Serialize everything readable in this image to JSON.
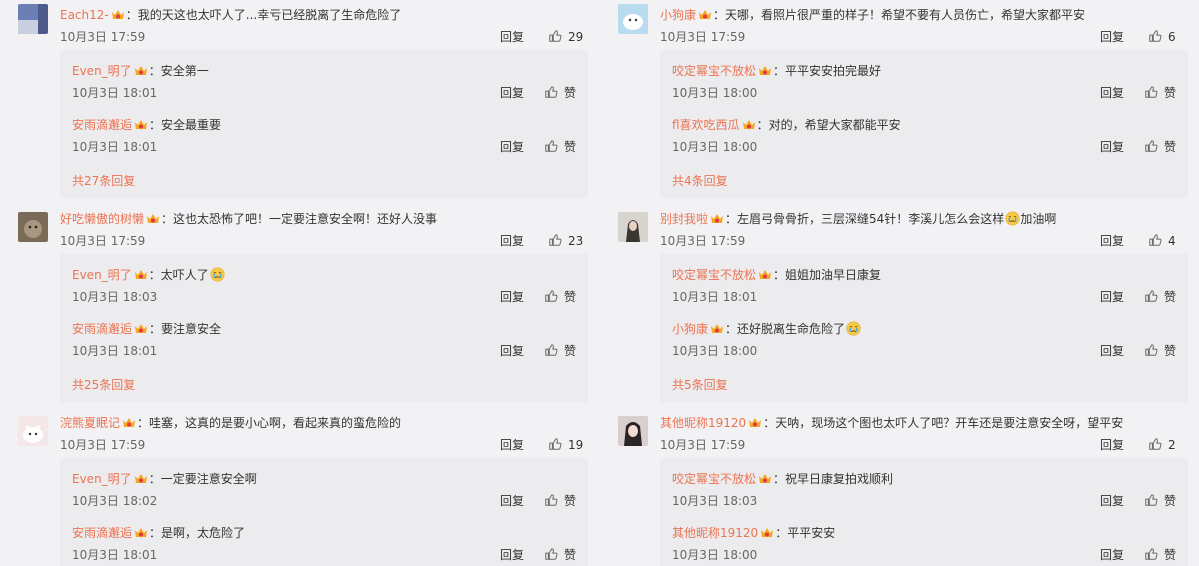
{
  "colors": {
    "name": "#eb7350",
    "text": "#333333",
    "meta": "#666666",
    "sub_bg": "#ececef"
  },
  "icons": {
    "vip": "vip-crown-icon",
    "like": "thumbs-up-icon",
    "emoji": "crying-face-icon"
  },
  "reply_label": "回复",
  "left": [
    {
      "user": "Each12-",
      "text": "我的天这也太吓人了...幸亏已经脱离了生命危险了",
      "time": "10月3日 17:59",
      "reply": "回复",
      "likes": "29",
      "subs": [
        {
          "user": "Even_明了",
          "text": "安全第一",
          "time": "10月3日 18:01",
          "reply": "回复",
          "like": "赞"
        },
        {
          "user": "安雨滴邂逅",
          "text": "安全最重要",
          "time": "10月3日 18:01",
          "reply": "回复",
          "like": "赞"
        }
      ],
      "more": "共27条回复"
    },
    {
      "user": "好吃懒傲的树懒",
      "text": "这也太恐怖了吧！一定要注意安全啊！还好人没事",
      "time": "10月3日 17:59",
      "reply": "回复",
      "likes": "23",
      "subs": [
        {
          "user": "Even_明了",
          "text": "太吓人了",
          "emoji": true,
          "time": "10月3日 18:03",
          "reply": "回复",
          "like": "赞"
        },
        {
          "user": "安雨滴邂逅",
          "text": "要注意安全",
          "time": "10月3日 18:01",
          "reply": "回复",
          "like": "赞"
        }
      ],
      "more": "共25条回复"
    },
    {
      "user": "浣熊夏眠记",
      "text": "哇塞，这真的是要小心啊，看起来真的蛮危险的",
      "time": "10月3日 17:59",
      "reply": "回复",
      "likes": "19",
      "subs": [
        {
          "user": "Even_明了",
          "text": "一定要注意安全啊",
          "time": "10月3日 18:02",
          "reply": "回复",
          "like": "赞"
        },
        {
          "user": "安雨滴邂逅",
          "text": "是啊，太危险了",
          "time": "10月3日 18:01",
          "reply": "回复",
          "like": "赞"
        }
      ],
      "more": ""
    }
  ],
  "right": [
    {
      "user": "小狗康",
      "text": "天哪，看照片很严重的样子！希望不要有人员伤亡，希望大家都平安",
      "time": "10月3日 17:59",
      "reply": "回复",
      "likes": "6",
      "subs": [
        {
          "user": "咬定幂宝不放松",
          "text": "平平安安拍完最好",
          "time": "10月3日 18:00",
          "reply": "回复",
          "like": "赞"
        },
        {
          "user": "fl喜欢吃西瓜",
          "text": "对的，希望大家都能平安",
          "time": "10月3日 18:00",
          "reply": "回复",
          "like": "赞"
        }
      ],
      "more": "共4条回复"
    },
    {
      "user": "别封我啦",
      "text": "左眉弓骨骨折，三层深缝54针！李溪儿怎么会这样",
      "text_after": "加油啊",
      "emoji": true,
      "time": "10月3日 17:59",
      "reply": "回复",
      "likes": "4",
      "subs": [
        {
          "user": "咬定幂宝不放松",
          "text": "姐姐加油早日康复",
          "time": "10月3日 18:01",
          "reply": "回复",
          "like": "赞"
        },
        {
          "user": "小狗康",
          "text": "还好脱离生命危险了",
          "emoji": true,
          "time": "10月3日 18:00",
          "reply": "回复",
          "like": "赞"
        }
      ],
      "more": "共5条回复"
    },
    {
      "user": "其他昵称19120",
      "text": "天呐，现场这个图也太吓人了吧？开车还是要注意安全呀，望平安",
      "time": "10月3日 17:59",
      "reply": "回复",
      "likes": "2",
      "subs": [
        {
          "user": "咬定幂宝不放松",
          "text": "祝早日康复拍戏顺利",
          "time": "10月3日 18:03",
          "reply": "回复",
          "like": "赞"
        },
        {
          "user": "其他昵称19120",
          "text": "平平安安",
          "time": "10月3日 18:00",
          "reply": "回复",
          "like": "赞"
        }
      ],
      "more": ""
    }
  ]
}
